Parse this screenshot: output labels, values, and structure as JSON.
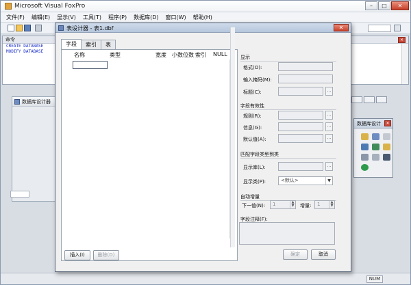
{
  "app": {
    "title": "Microsoft Visual FoxPro",
    "menu": [
      "文件(F)",
      "编辑(E)",
      "显示(V)",
      "工具(T)",
      "程序(P)",
      "数据库(D)",
      "窗口(W)",
      "帮助(H)"
    ]
  },
  "command_window": {
    "title": "命令",
    "lines": [
      "CREATE DATABASE",
      "MODIFY DATABASE"
    ]
  },
  "child_window": {
    "title": "数据库设计器"
  },
  "palette": {
    "title": "数据库设计"
  },
  "status": {
    "num": "NUM"
  },
  "dialog": {
    "title": "表设计器 - 表1.dbf",
    "close_label": "✕",
    "tabs": [
      "字段",
      "索引",
      "表"
    ],
    "columns": [
      "名称",
      "类型",
      "宽度",
      "小数位数",
      "索引",
      "NULL"
    ],
    "buttons": {
      "insert": "插入(I)",
      "delete": "删除(D)",
      "ok": "确定",
      "cancel": "取消"
    },
    "display_group": {
      "title": "显示",
      "format": "格式(O):",
      "input_mask": "输入掩码(M):",
      "caption": "标题(C):"
    },
    "validation_group": {
      "title": "字段有效性",
      "rule": "规则(R):",
      "message": "信息(G):",
      "default": "默认值(A):"
    },
    "mapping_group": {
      "title": "匹配字段类型到类",
      "library": "显示库(L):",
      "class": "显示类(P):",
      "class_value": "<默认>"
    },
    "autoinc_group": {
      "title": "自动增量",
      "next_value_label": "下一值(N):",
      "next_value": "1",
      "step_label": "增量:",
      "step": "1"
    },
    "comment_label": "字段注释(F):"
  }
}
